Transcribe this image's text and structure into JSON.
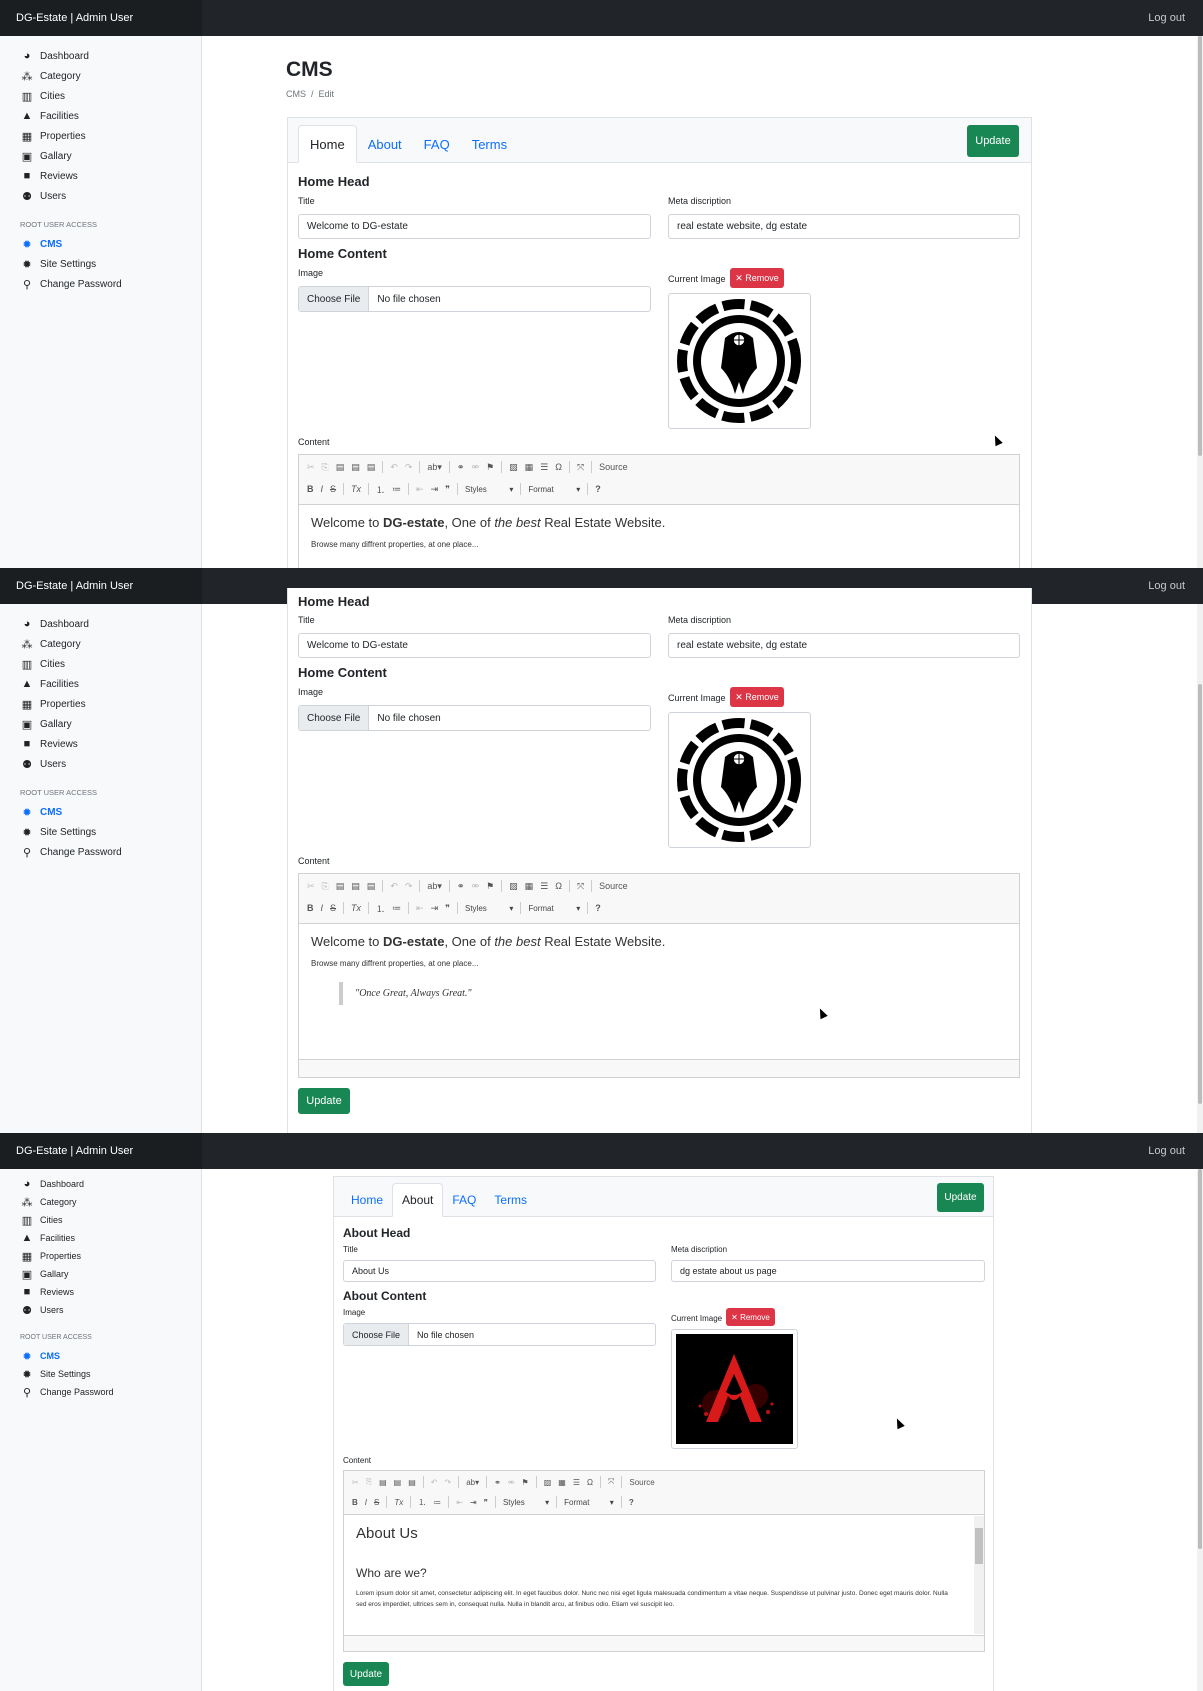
{
  "topbar": {
    "brand": "DG-Estate | Admin User",
    "logout": "Log out"
  },
  "sidebar": {
    "items": [
      {
        "label": "Dashboard",
        "icon": "dashboard-icon"
      },
      {
        "label": "Category",
        "icon": "category-icon"
      },
      {
        "label": "Cities",
        "icon": "city-icon"
      },
      {
        "label": "Facilities",
        "icon": "facilities-icon"
      },
      {
        "label": "Properties",
        "icon": "building-icon"
      },
      {
        "label": "Gallary",
        "icon": "gallery-icon"
      },
      {
        "label": "Reviews",
        "icon": "comment-icon"
      },
      {
        "label": "Users",
        "icon": "users-icon"
      }
    ],
    "root_heading": "ROOT USER ACCESS",
    "root_items": [
      {
        "label": "CMS",
        "icon": "gear-icon",
        "active": true
      },
      {
        "label": "Site Settings",
        "icon": "gear-icon"
      },
      {
        "label": "Change Password",
        "icon": "key-icon"
      }
    ]
  },
  "page": {
    "title": "CMS",
    "breadcrumb": [
      "CMS",
      "Edit"
    ],
    "breadcrumb_sep": "/"
  },
  "tabs": [
    "Home",
    "About",
    "FAQ",
    "Terms"
  ],
  "update_label": "Update",
  "remove_label": "✕ Remove",
  "home": {
    "head_title": "Home Head",
    "title_label": "Title",
    "title_value": "Welcome to DG-estate",
    "meta_label": "Meta discription",
    "meta_value": "real estate website, dg estate",
    "content_title": "Home Content",
    "image_label": "Image",
    "choose_file": "Choose File",
    "no_file": "No file chosen",
    "current_image": "Current Image",
    "content_label": "Content",
    "editor": {
      "line1_a": "Welcome to ",
      "line1_b": "DG-estate",
      "line1_c": ", One of ",
      "line1_d": "the best",
      "line1_e": " Real Estate Website.",
      "line2": "Browse many diffrent properties, at one place...",
      "quote": "\"Once Great, Always Great.\""
    }
  },
  "about": {
    "head_title": "About Head",
    "title_label": "Title",
    "title_value": "About Us",
    "meta_label": "Meta discription",
    "meta_value": "dg estate about us page",
    "content_title": "About Content",
    "image_label": "Image",
    "choose_file": "Choose File",
    "no_file": "No file chosen",
    "current_image": "Current Image",
    "content_label": "Content",
    "editor": {
      "heading": "About Us",
      "subheading": "Who are we?",
      "para": "Lorem ipsum dolor sit amet, consectetur adipiscing elit. In eget faucibus dolor. Nunc nec nisi eget ligula malesuada condimentum a vitae neque. Suspendisse ut pulvinar justo. Donec eget mauris dolor. Nulla sed eros imperdiet, ultrices sem in, consequat nulla. Nulla in blandit arcu, at finibus odio. Etiam vel suscipit leo."
    }
  },
  "toolbar": {
    "source": "Source",
    "styles": "Styles",
    "format": "Format",
    "help": "?"
  }
}
